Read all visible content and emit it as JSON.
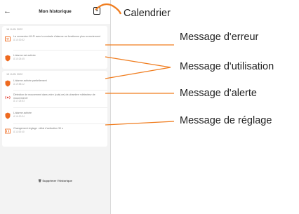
{
  "header": {
    "title": "Mon historique",
    "back_icon": "arrow-left-icon",
    "calendar_icon": "calendar-icon",
    "calendar_digit": "1"
  },
  "groups": [
    {
      "date": "16 JUIN 2022"
    },
    {
      "date": "15 JUIN 2022"
    }
  ],
  "messages": [
    {
      "icon": "wifi-error-icon",
      "text": "La connexion Wi-Fi avec la centrale d'alarme ne fonctionne plus correctement",
      "time": "À 10:30:52"
    },
    {
      "icon": "shield-icon",
      "text": "L'alarme est activée",
      "time": "À 10:24:45"
    },
    {
      "icon": "shield-icon",
      "text": "L'alarme activée partiellement",
      "time": "À 19:58:12"
    },
    {
      "icon": "motion-icon",
      "text": "Détection de mouvement dans votre (cuisi-ne) de-chambre «détecteur de mouvement»",
      "time": "À 17:24:53"
    },
    {
      "icon": "shield-icon",
      "text": "L'alarme activée",
      "time": "À 16:20:34"
    },
    {
      "icon": "settings-icon",
      "text": "Changement réglage : délai d'activation 30 s",
      "time": "À 11:53:40"
    }
  ],
  "footer": {
    "delete_label": "Supprimer l'historique",
    "delete_icon": "trash-icon"
  },
  "callouts": {
    "calendar": "Calendrier",
    "error": "Message d'erreur",
    "usage": "Message d'utilisation",
    "alert": "Message d'alerte",
    "settings": "Message de réglage"
  },
  "colors": {
    "accent": "#f07d1f",
    "orange_icon": "#ee6a1f",
    "red_icon": "#e2463a"
  }
}
